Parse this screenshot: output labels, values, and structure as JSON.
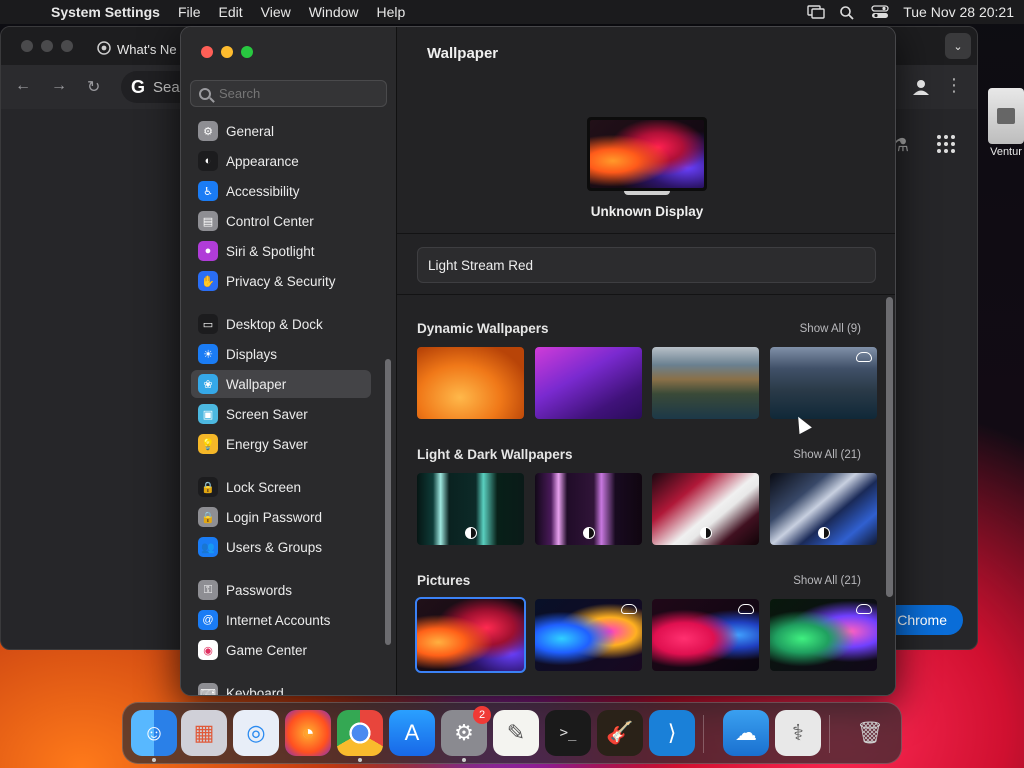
{
  "menubar": {
    "app_name": "System Settings",
    "menus": [
      "File",
      "Edit",
      "View",
      "Window",
      "Help"
    ],
    "datetime": "Tue Nov 28  20:21"
  },
  "chrome": {
    "tab_title": "What's Ne",
    "omnibox_text": "Sea",
    "button_label": "Chrome"
  },
  "desktop": {
    "icon_label": "Ventur"
  },
  "settings": {
    "search_placeholder": "Search",
    "sidebar": [
      {
        "label": "General",
        "icon": "gear-icon",
        "color": "#8e8e93",
        "glyph": "⚙"
      },
      {
        "label": "Appearance",
        "icon": "appearance-icon",
        "color": "#1c1c1e",
        "glyph": "◐"
      },
      {
        "label": "Accessibility",
        "icon": "accessibility-icon",
        "color": "#1a7cf5",
        "glyph": "♿"
      },
      {
        "label": "Control Center",
        "icon": "control-center-icon",
        "color": "#8e8e93",
        "glyph": "▤"
      },
      {
        "label": "Siri & Spotlight",
        "icon": "siri-icon",
        "color": "#b03cd8",
        "glyph": "●"
      },
      {
        "label": "Privacy & Security",
        "icon": "hand-icon",
        "color": "#2a6ef5",
        "glyph": "✋"
      },
      {
        "label": "Desktop & Dock",
        "icon": "dock-icon",
        "color": "#1c1c1e",
        "glyph": "▭"
      },
      {
        "label": "Displays",
        "icon": "displays-icon",
        "color": "#1a7cf5",
        "glyph": "☀"
      },
      {
        "label": "Wallpaper",
        "icon": "wallpaper-icon",
        "color": "#35a8e8",
        "glyph": "❀"
      },
      {
        "label": "Screen Saver",
        "icon": "screen-saver-icon",
        "color": "#4cb8e0",
        "glyph": "▣"
      },
      {
        "label": "Energy Saver",
        "icon": "energy-icon",
        "color": "#f5b728",
        "glyph": "💡"
      },
      {
        "label": "Lock Screen",
        "icon": "lock-icon",
        "color": "#1c1c1e",
        "glyph": "🔒"
      },
      {
        "label": "Login Password",
        "icon": "login-lock-icon",
        "color": "#8e8e93",
        "glyph": "🔒"
      },
      {
        "label": "Users & Groups",
        "icon": "users-icon",
        "color": "#1a7cf5",
        "glyph": "👥"
      },
      {
        "label": "Passwords",
        "icon": "key-icon",
        "color": "#8e8e93",
        "glyph": "⚿"
      },
      {
        "label": "Internet Accounts",
        "icon": "at-icon",
        "color": "#1a7cf5",
        "glyph": "@"
      },
      {
        "label": "Game Center",
        "icon": "game-center-icon",
        "color": "#ffffff",
        "glyph": "◉"
      },
      {
        "label": "Keyboard",
        "icon": "keyboard-icon",
        "color": "#8e8e93",
        "glyph": "⌨"
      }
    ],
    "selected": "Wallpaper",
    "main": {
      "title": "Wallpaper",
      "display_name": "Unknown Display",
      "current_wallpaper": "Light Stream Red",
      "sections": [
        {
          "title": "Dynamic Wallpapers",
          "show_all": "Show All (9)"
        },
        {
          "title": "Light & Dark Wallpapers",
          "show_all": "Show All (21)"
        },
        {
          "title": "Pictures",
          "show_all": "Show All (21)"
        }
      ]
    }
  },
  "dock": {
    "apps": [
      "Finder",
      "Launchpad",
      "Safari",
      "Firefox",
      "Chrome",
      "App Store",
      "System Settings",
      "TextEdit",
      "Terminal",
      "GarageBand",
      "VS Code",
      "Weather",
      "Disk Utility",
      "Trash"
    ],
    "settings_badge": "2"
  },
  "colors": {
    "accent": "#3b82f6",
    "chrome_button": "#0a6dd8",
    "close": "#ff5f57",
    "minimize": "#febc2e",
    "zoom": "#28c840"
  }
}
